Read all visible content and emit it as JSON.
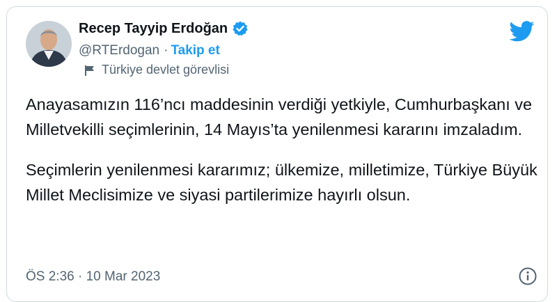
{
  "author": {
    "name": "Recep Tayyip Erdoğan",
    "handle": "@RTErdogan",
    "separator": "·",
    "follow_label": "Takip et",
    "account_label": "Türkiye devlet görevlisi"
  },
  "tweet": {
    "paragraphs": [
      "Anayasamızın 116’ncı maddesinin verdiği yetkiyle, Cumhurbaşkanı ve Milletvekilli seçimlerinin, 14 Mayıs’ta yenilenmesi kararını imzaladım.",
      "Seçimlerin yenilenmesi kararımız; ülkemize, milletimize, Türkiye Büyük Millet Meclisimize ve siyasi partilerimize hayırlı olsun."
    ],
    "timestamp": "ÖS 2:36 · 10 Mar 2023"
  },
  "icons": {
    "verified": "verified-badge-icon",
    "twitter": "twitter-bird-icon",
    "label": "flag-icon",
    "info": "info-icon"
  },
  "colors": {
    "accent": "#1d9bf0",
    "text": "#0f1419",
    "secondary": "#536471",
    "border": "#cfd9de"
  }
}
